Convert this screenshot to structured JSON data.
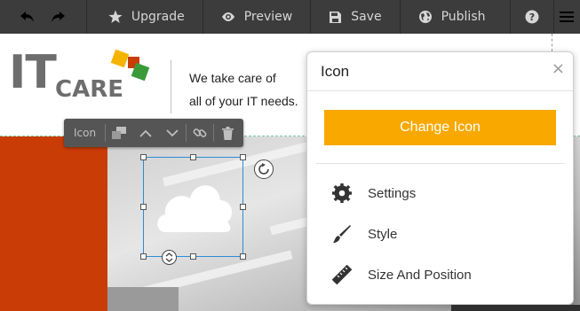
{
  "toolbar": {
    "undo_icon": "undo-icon",
    "redo_icon": "redo-icon",
    "upgrade_label": "Upgrade",
    "preview_label": "Preview",
    "save_label": "Save",
    "publish_label": "Publish",
    "help_icon": "help-icon",
    "menu_icon": "hamburger-menu-icon"
  },
  "site": {
    "logo_it": "IT",
    "logo_care": "CARE",
    "tagline_line1": "We  take care of",
    "tagline_line2": "all of your IT needs.",
    "logo_colors": [
      "#f5b400",
      "#c93c06",
      "#3a9a3a"
    ]
  },
  "element_bar": {
    "label": "Icon",
    "icons": [
      "layers-icon",
      "move-up-icon",
      "move-down-icon",
      "link-icon",
      "trash-icon"
    ]
  },
  "panel": {
    "title": "Icon",
    "close": "×",
    "change_button": "Change Icon",
    "items": [
      {
        "label": "Settings",
        "icon": "gear-icon"
      },
      {
        "label": "Style",
        "icon": "brush-icon"
      },
      {
        "label": "Size And Position",
        "icon": "ruler-icon"
      }
    ]
  },
  "colors": {
    "accent": "#f9a800",
    "toolbar_bg": "#3c3c3c",
    "selection": "#2d8bd6",
    "hero_orange": "#c93c06"
  }
}
